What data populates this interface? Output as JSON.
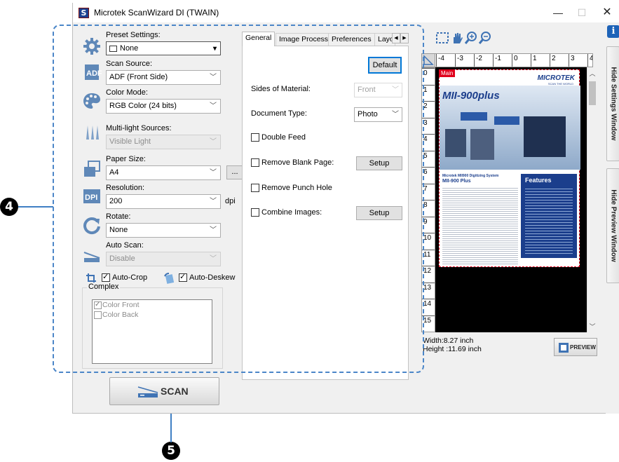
{
  "window": {
    "title": "Microtek ScanWizard DI (TWAIN)",
    "app_icon_letter": "S",
    "controls": {
      "minimize": "—",
      "maximize": "☐",
      "close": "✕"
    }
  },
  "settings": {
    "preset": {
      "label": "Preset Settings:",
      "value": "None"
    },
    "scan_source": {
      "label": "Scan Source:",
      "value": "ADF (Front Side)"
    },
    "color_mode": {
      "label": "Color Mode:",
      "value": "RGB Color (24 bits)"
    },
    "multi_light": {
      "label": "Multi-light Sources:",
      "value": "Visible Light"
    },
    "paper_size": {
      "label": "Paper Size:",
      "value": "A4",
      "more_button": "..."
    },
    "resolution": {
      "label": "Resolution:",
      "value": "200",
      "unit": "dpi"
    },
    "rotate": {
      "label": "Rotate:",
      "value": "None"
    },
    "auto_scan": {
      "label": "Auto Scan:",
      "value": "Disable"
    },
    "auto_crop": {
      "label": "Auto-Crop",
      "checked": true
    },
    "auto_deskew": {
      "label": "Auto-Deskew",
      "checked": true
    },
    "complex": {
      "title": "Complex",
      "items": [
        {
          "label": "Color Front",
          "checked": true
        },
        {
          "label": "Color Back",
          "checked": false
        }
      ]
    }
  },
  "tabs": {
    "items": [
      "General",
      "Image Process",
      "Preferences",
      "Layo"
    ],
    "active": "General"
  },
  "general": {
    "default_button": "Default",
    "sides_of_material": {
      "label": "Sides of Material:",
      "value": "Front"
    },
    "document_type": {
      "label": "Document Type:",
      "value": "Photo"
    },
    "double_feed": {
      "label": "Double Feed",
      "checked": false
    },
    "remove_blank_page": {
      "label": "Remove Blank Page:",
      "checked": false,
      "button": "Setup"
    },
    "remove_punch_hole": {
      "label": "Remove Punch Hole",
      "checked": false
    },
    "combine_images": {
      "label": "Combine Images:",
      "checked": false,
      "button": "Setup"
    }
  },
  "scan_button": {
    "label": "SCAN"
  },
  "preview": {
    "ruler_top": [
      "-4",
      "-3",
      "-2",
      "-1",
      "0",
      "1",
      "2",
      "3",
      "4"
    ],
    "ruler_left": [
      "0",
      "1",
      "2",
      "3",
      "4",
      "5",
      "6",
      "7",
      "8",
      "9",
      "10",
      "11",
      "12",
      "13",
      "14",
      "15"
    ],
    "main_tag": "Main",
    "width_text": "Width:8.27 inch",
    "height_text": "Height :11.69 inch",
    "preview_button": "PREVIEW",
    "document": {
      "brand": "MICROTEK",
      "brand_sub": "SCAN THE WORLD",
      "product": "MII-900plus",
      "features_title": "Features",
      "subheading": "Microtek MII900 Digitizing System",
      "model": "MII-900 Plus"
    }
  },
  "side_panel": {
    "info": "i",
    "hide_settings": "Hide Settings Window",
    "hide_preview": "Hide Preview Window"
  },
  "callouts": [
    "4",
    "5"
  ],
  "colors": {
    "accent": "#0078d7",
    "dashed_frame": "#4b86c8",
    "preview_bg": "#000000",
    "main_tag": "#e0001b"
  }
}
